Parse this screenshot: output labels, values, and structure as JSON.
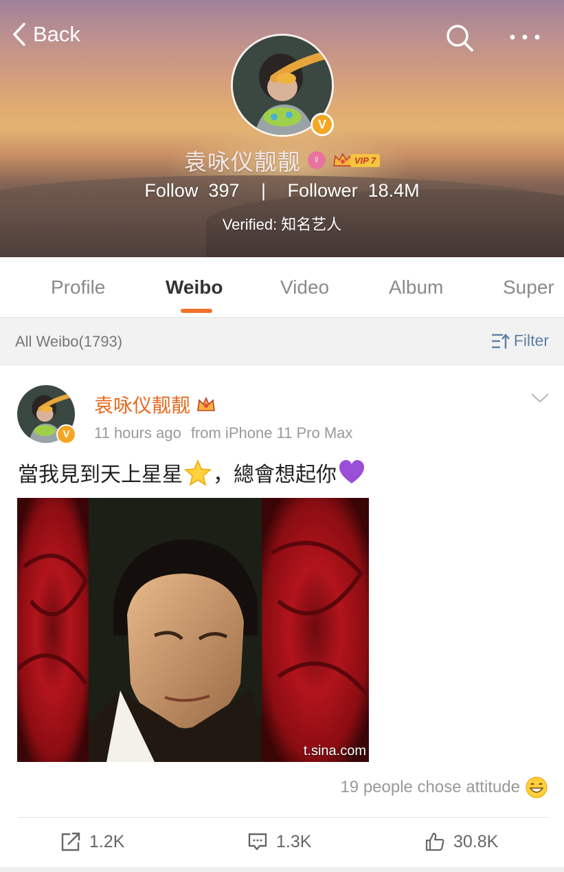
{
  "header": {
    "back_label": "Back",
    "username": "袁咏仪靓靓",
    "vip_level": "VIP 7",
    "gender_symbol": "♀",
    "verified_badge": "V",
    "follow_label": "Follow",
    "follow_count": "397",
    "separator": "|",
    "follower_label": "Follower",
    "follower_count": "18.4M",
    "verified_text": "Verified: 知名艺人"
  },
  "tabs": [
    {
      "label": "Profile",
      "active": false
    },
    {
      "label": "Weibo",
      "active": true
    },
    {
      "label": "Video",
      "active": false
    },
    {
      "label": "Album",
      "active": false
    },
    {
      "label": "Super",
      "active": false
    }
  ],
  "filter_bar": {
    "count_label": "All Weibo(1793)",
    "filter_label": "Filter"
  },
  "post": {
    "author": "袁咏仪靓靓",
    "verified_badge": "V",
    "time": "11 hours ago",
    "source": "from iPhone 11 Pro Max",
    "text_part1": "當我見到天上星星",
    "text_part2": "，總會想起你",
    "image_watermark": "t.sina.com",
    "attitude_text": "19 people chose attitude",
    "reposts": "1.2K",
    "comments": "1.3K",
    "likes": "30.8K"
  },
  "colors": {
    "accent_orange": "#f3712b",
    "author_orange": "#e8691c",
    "link_blue": "#5b7ea8",
    "verified_gold": "#f5a623"
  }
}
